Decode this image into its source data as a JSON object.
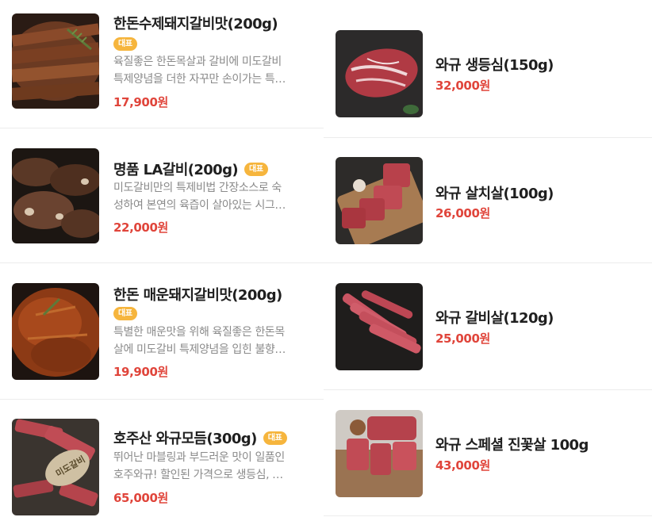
{
  "colors": {
    "price": "#e0453b",
    "badge": "#f6b53d",
    "divider": "#ececec"
  },
  "left_items": [
    {
      "title": "한돈수제돼지갈비맛(200g)",
      "badge": "대표",
      "desc_line1": "육질좋은 한돈목살과 갈비에 미도갈비",
      "desc_line2": "특제양념을 더한 자꾸만 손이가는 특…",
      "price": "17,900원",
      "image": "marinated-pork-ribs-photo"
    },
    {
      "title": "명품 LA갈비(200g)",
      "badge": "대표",
      "desc_line1": "미도갈비만의 특제비법 간장소스로 숙",
      "desc_line2": "성하여 본연의 육즙이 살아있는 시그…",
      "price": "22,000원",
      "image": "la-galbi-grill-photo"
    },
    {
      "title": "한돈 매운돼지갈비맛(200g)",
      "badge": "대표",
      "desc_line1": "특별한 매운맛을 위해 육질좋은 한돈목",
      "desc_line2": "살에 미도갈비 특제양념을 입힌 불향…",
      "price": "19,900원",
      "image": "spicy-pork-ribs-photo"
    },
    {
      "title": "호주산 와규모듬(300g)",
      "badge": "대표",
      "desc_line1": "뛰어난 마블링과 부드러운 맛이 일품인",
      "desc_line2": "호주와규! 할인된 가격으로 생등심, …",
      "price": "65,000원",
      "image": "wagyu-assortment-photo",
      "image_text": "미도갈비"
    }
  ],
  "right_items": [
    {
      "title": "와규 생등심(150g)",
      "price": "32,000원",
      "image": "wagyu-sirloin-photo"
    },
    {
      "title": "와규 살치살(100g)",
      "price": "26,000원",
      "image": "wagyu-chuck-flap-photo"
    },
    {
      "title": "와규 갈비살(120g)",
      "price": "25,000원",
      "image": "wagyu-rib-finger-photo"
    },
    {
      "title": "와규 스페셜 진꽃살 100g",
      "price": "43,000원",
      "image": "wagyu-special-cut-photo"
    }
  ]
}
